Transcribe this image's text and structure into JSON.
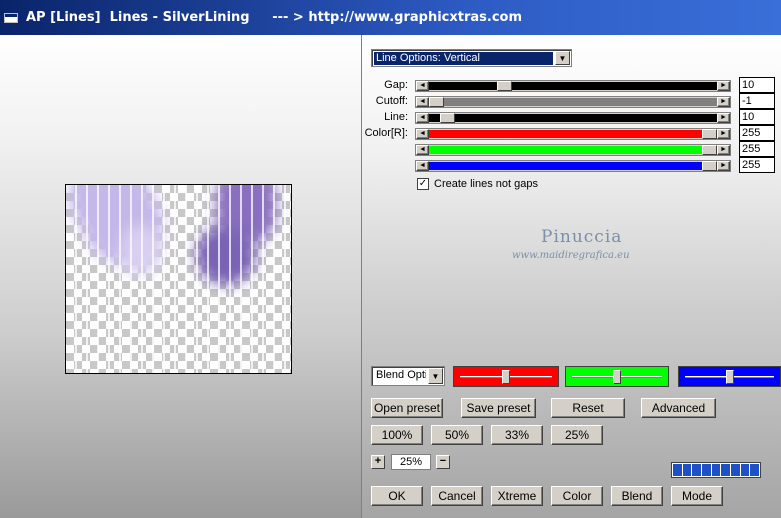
{
  "window": {
    "title": "AP [Lines]  Lines - SilverLining     --- > http://www.graphicxtras.com"
  },
  "mode_select": {
    "value": "Line Options: Vertical"
  },
  "sliders": [
    {
      "label": "Gap:",
      "value": "10",
      "level": 0.25,
      "color": "#000000"
    },
    {
      "label": "Cutoff:",
      "value": "-1",
      "level": 0.0,
      "color": "#808080"
    },
    {
      "label": "Line:",
      "value": "10",
      "level": 0.04,
      "color": "#000000"
    },
    {
      "label": "Color[R]:",
      "value": "255",
      "level": 1.0,
      "color": "#ff0000"
    },
    {
      "label": "",
      "value": "255",
      "level": 1.0,
      "color": "#00ff00"
    },
    {
      "label": "",
      "value": "255",
      "level": 1.0,
      "color": "#0000ff"
    }
  ],
  "checkbox": {
    "label": "Create lines not gaps",
    "checked": true,
    "mark": "✓"
  },
  "watermark": {
    "name": "Pinuccia",
    "url": "www.maidiregrafica.eu"
  },
  "blend": {
    "value": "Blend Optio",
    "levels": {
      "red": 0.5,
      "green": 0.5,
      "blue": 0.5
    }
  },
  "buttons": {
    "open_preset": "Open preset",
    "save_preset": "Save preset",
    "reset": "Reset",
    "advanced": "Advanced",
    "zoom_100": "100%",
    "zoom_50": "50%",
    "zoom_33": "33%",
    "zoom_25": "25%",
    "ok": "OK",
    "cancel": "Cancel",
    "xtreme": "Xtreme",
    "color": "Color",
    "blend": "Blend",
    "mode": "Mode"
  },
  "zoom": {
    "plus": "+",
    "minus": "−",
    "value": "25%"
  },
  "progress": {
    "segments": 9,
    "filled": 9
  },
  "colors": {
    "titlebar": "#0a246a",
    "preview_purple": "#8a6fc0"
  }
}
